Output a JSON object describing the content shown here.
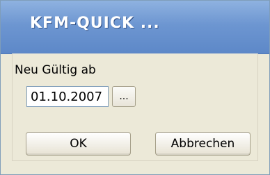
{
  "window": {
    "title": "KFM-QUICK ..."
  },
  "form": {
    "label": "Neu Gültig ab",
    "date_value": "01.10.2007",
    "picker_label": "..."
  },
  "buttons": {
    "ok_label": "OK",
    "cancel_label": "Abbrechen"
  },
  "colors": {
    "title_bar": "#6d96d1",
    "dialog_background": "#ece9d8",
    "input_border": "#7f9db9"
  }
}
